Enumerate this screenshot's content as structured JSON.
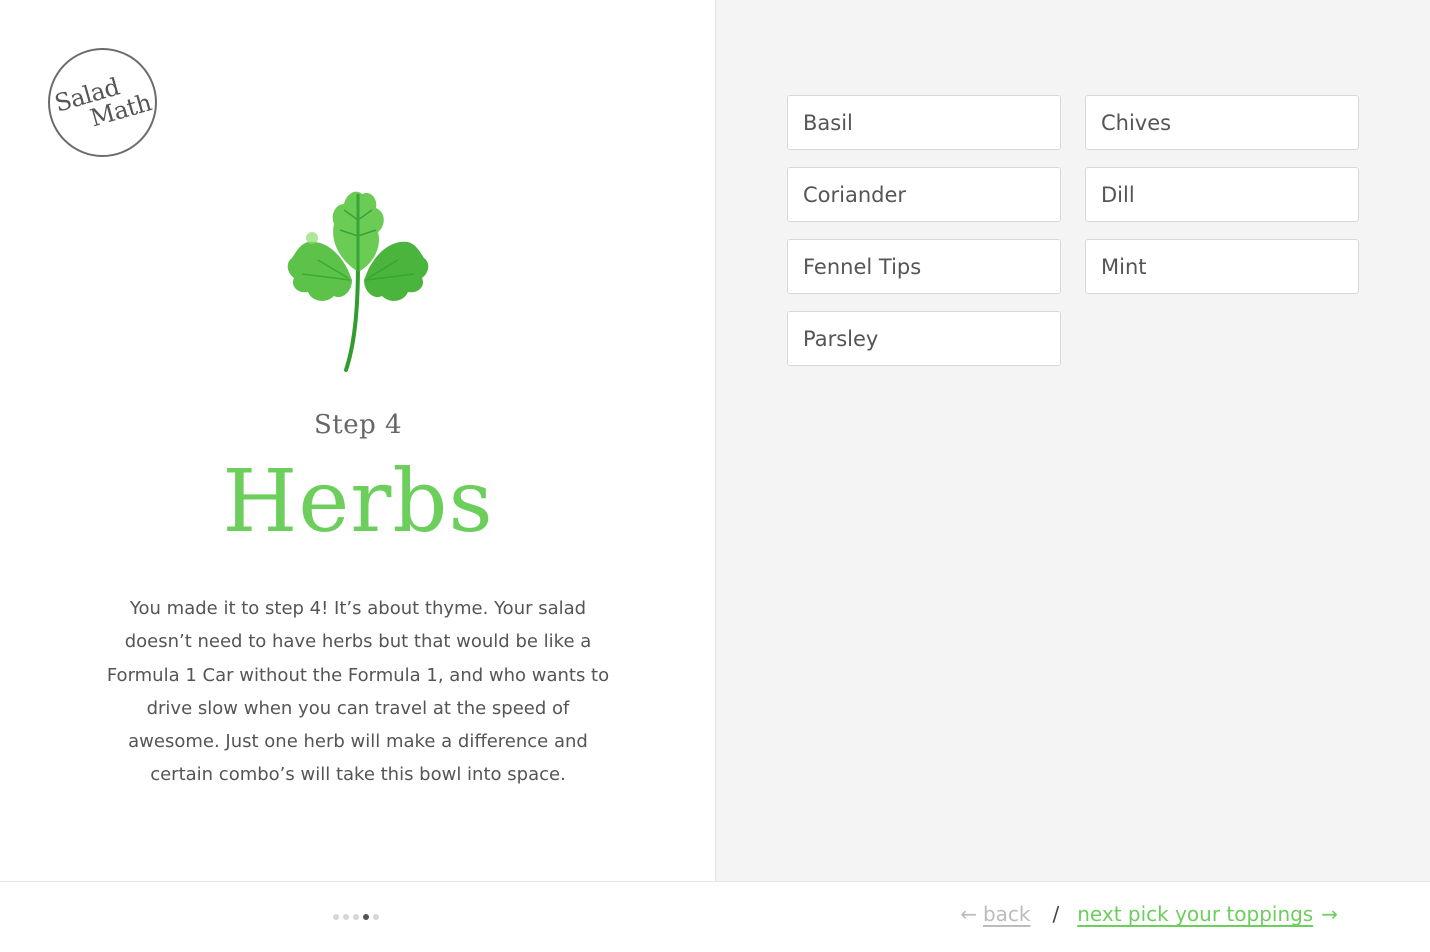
{
  "brand": {
    "line1": "Salad",
    "line2": "Math"
  },
  "step": {
    "label": "Step 4",
    "title": "Herbs"
  },
  "description": "You made it to step 4! It’s about thyme. Your salad doesn’t need to have herbs but that would be like a Formula 1 Car without the Formula 1, and who wants to drive slow when you can travel at the speed of awesome. Just one herb will make a difference and certain combo’s will take this bowl into space.",
  "options": [
    {
      "label": "Basil"
    },
    {
      "label": "Chives"
    },
    {
      "label": "Coriander"
    },
    {
      "label": "Dill"
    },
    {
      "label": "Fennel Tips"
    },
    {
      "label": "Mint"
    },
    {
      "label": "Parsley"
    }
  ],
  "pager": {
    "total": 5,
    "current": 4
  },
  "nav": {
    "back_arrow": "←",
    "back_label": "back",
    "separator": "/",
    "next_label": "next pick your toppings",
    "next_arrow": "→"
  },
  "colors": {
    "accent": "#6ccf5c",
    "panel_bg": "#f4f4f4",
    "text": "#555555"
  },
  "icons": {
    "illustration": "coriander-leaf-icon"
  }
}
